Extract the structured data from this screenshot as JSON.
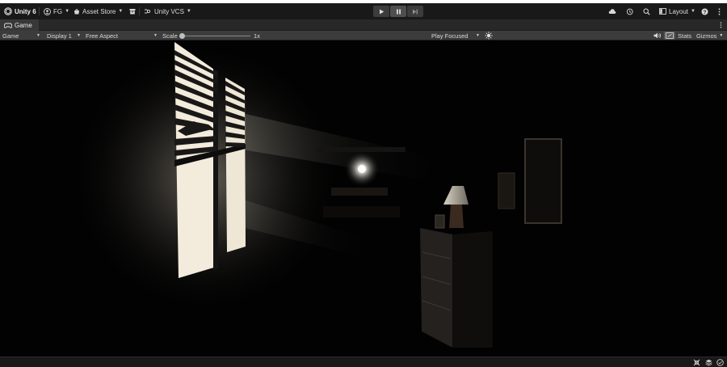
{
  "topbar": {
    "app_title": "Unity 6",
    "account_label": "FG",
    "asset_store_label": "Asset Store",
    "vcs_label": "Unity VCS",
    "layout_label": "Layout"
  },
  "game_tab": {
    "label": "Game"
  },
  "game_toolbar": {
    "view_mode": "Game",
    "display": "Display 1",
    "aspect": "Free Aspect",
    "scale_label": "Scale",
    "scale_value": "1x",
    "scale_level": 0.0,
    "play_mode": "Play Focused",
    "stats_label": "Stats",
    "gizmos_label": "Gizmos"
  },
  "play_controls": {
    "play_active": false,
    "pause_active": true
  },
  "colors": {
    "topbar_bg": "#191919",
    "toolbar_bg": "#3c3c3c",
    "viewport_bg": "#020202",
    "window_light": "#f3ecdd"
  },
  "icons": [
    "unity-logo-icon",
    "account-icon",
    "asset-store-icon",
    "package-icon",
    "vcs-icon",
    "play-icon",
    "pause-icon",
    "step-icon",
    "cloud-icon",
    "history-icon",
    "search-icon",
    "layout-icon",
    "help-icon",
    "more-icon",
    "game-controller-icon",
    "sun-icon",
    "audio-icon",
    "maximize-icon",
    "debug-icon",
    "layers-icon",
    "check-circle-icon"
  ]
}
